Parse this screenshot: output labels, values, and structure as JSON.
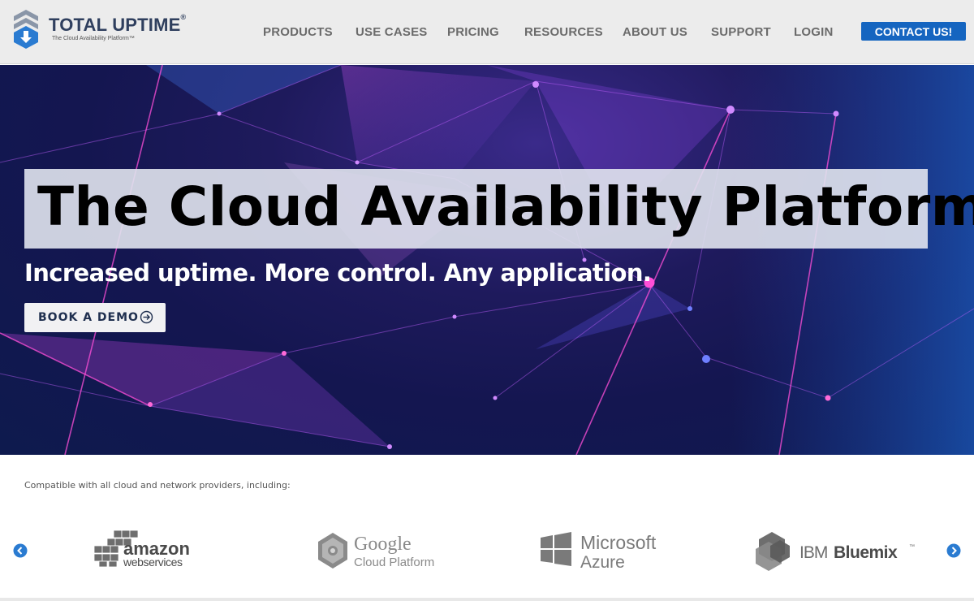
{
  "brand": {
    "name": "TOTAL UPTIME",
    "reg": "®",
    "tagline": "The Cloud Availability Platform™",
    "colors": {
      "navy": "#2f3f5e",
      "blue": "#2a7bd1"
    }
  },
  "nav": {
    "items": [
      "PRODUCTS",
      "USE CASES",
      "PRICING",
      "RESOURCES",
      "ABOUT US",
      "SUPPORT",
      "LOGIN"
    ],
    "contact_label": "CONTACT US!"
  },
  "hero": {
    "title": "The Cloud Availability Platform",
    "title_mark": "®",
    "subtitle": "Increased uptime. More control. Any application.",
    "cta_label": "BOOK A DEMO",
    "cta_icon": "arrow-right-circle-icon"
  },
  "providers": {
    "intro": "Compatible with all cloud and network providers, including:",
    "prev_icon": "chevron-left-circle-icon",
    "next_icon": "chevron-right-circle-icon",
    "logos": [
      {
        "name": "amazon web services",
        "line1": "amazon",
        "line2": "webservices"
      },
      {
        "name": "Google Cloud Platform",
        "line1": "Google",
        "line2": "Cloud Platform"
      },
      {
        "name": "Microsoft Azure",
        "line1": "Microsoft",
        "line2": "Azure"
      },
      {
        "name": "IBM Bluemix",
        "line1": "IBM",
        "line2": "Bluemix",
        "mark": "™"
      }
    ]
  }
}
